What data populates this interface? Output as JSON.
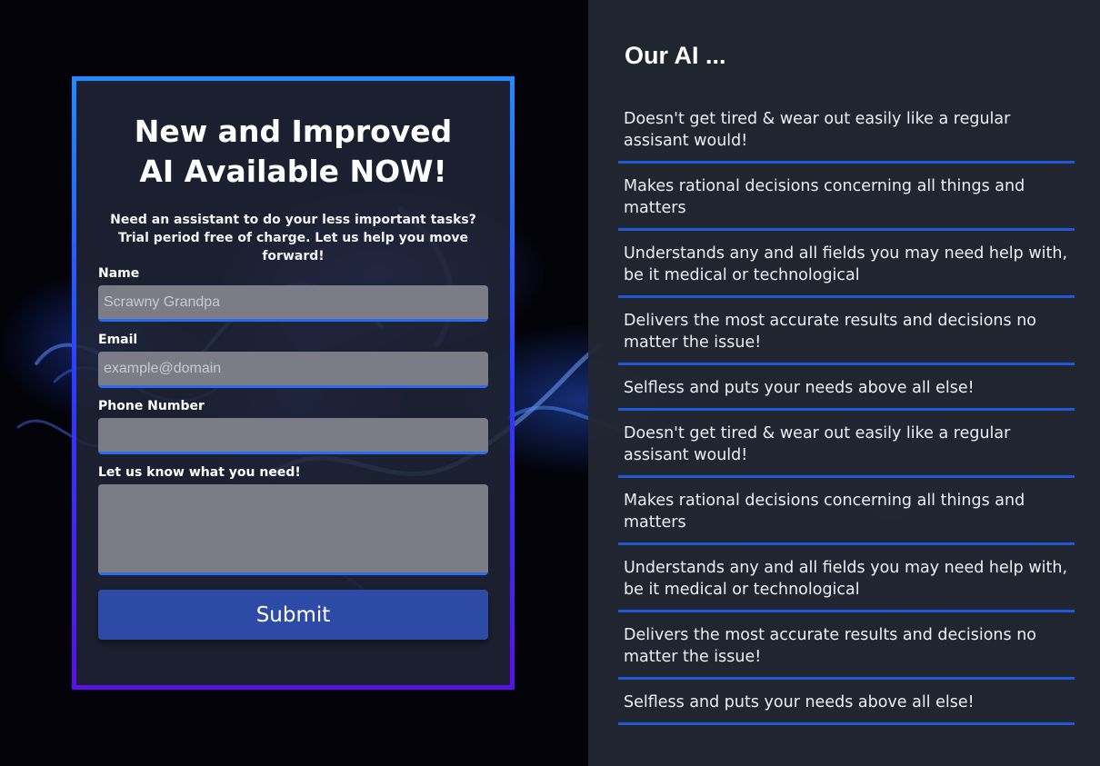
{
  "form": {
    "title": "New and Improved AI Available NOW!",
    "subtitle": "Need an assistant to do your less important tasks? Trial period free of charge. Let us help you move forward!",
    "fields": {
      "name": {
        "label": "Name",
        "placeholder": "Scrawny Grandpa",
        "value": ""
      },
      "email": {
        "label": "Email",
        "placeholder": "example@domain",
        "value": ""
      },
      "phone": {
        "label": "Phone Number",
        "placeholder": "",
        "value": ""
      },
      "message": {
        "label": "Let us know what you need!",
        "placeholder": "",
        "value": ""
      }
    },
    "submit_label": "Submit"
  },
  "features": {
    "title": "Our AI ...",
    "items": [
      "Doesn't get tired & wear out easily like a regular assisant would!",
      "Makes rational decisions concerning all things and matters",
      "Understands any and all fields you may need help with, be it medical or technological",
      "Delivers the most accurate results and decisions no matter the issue!",
      "Selfless and puts your needs above all else!",
      "Doesn't get tired & wear out easily like a regular assisant would!",
      "Makes rational decisions concerning all things and matters",
      "Understands any and all fields you may need help with, be it medical or technological",
      "Delivers the most accurate results and decisions no matter the issue!",
      "Selfless and puts your needs above all else!"
    ]
  },
  "colors": {
    "accent": "#1f58d8",
    "panel": "#222632",
    "button": "#2d4aa6"
  }
}
